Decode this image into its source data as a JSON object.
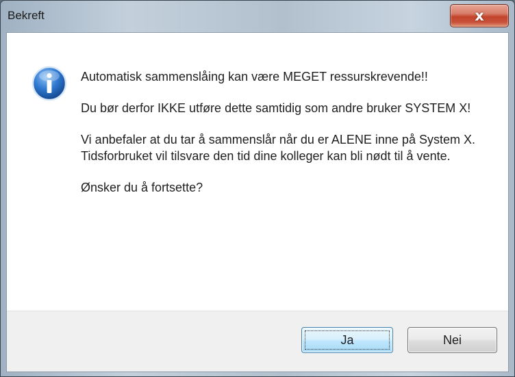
{
  "window": {
    "title": "Bekreft",
    "close_glyph": "x"
  },
  "dialog": {
    "icon": "info-icon",
    "message": [
      "Automatisk sammenslåing kan være MEGET ressurskrevende!!",
      "Du bør derfor IKKE utføre dette samtidig som andre bruker SYSTEM X!",
      "Vi anbefaler at du tar å sammenslår når du er ALENE inne på System X. Tidsforbruket vil tilsvare den tid dine kolleger kan bli nødt til å vente.",
      "Ønsker du å fortsette?"
    ]
  },
  "buttons": {
    "yes_label": "Ja",
    "no_label": "Nei"
  },
  "colors": {
    "accent": "#3c7fb1",
    "close_red": "#c2452a",
    "info_blue": "#1d5fb0"
  }
}
